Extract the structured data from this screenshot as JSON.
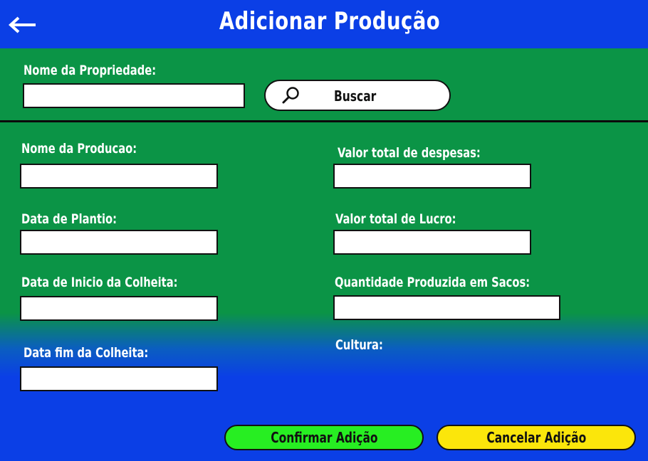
{
  "header": {
    "title": "Adicionar Produção",
    "back_icon": "arrow-left-icon"
  },
  "search_section": {
    "property_label": "Nome da Propriedade:",
    "property_value": "",
    "search_button_label": "Buscar",
    "search_icon": "magnifier-icon"
  },
  "form": {
    "left": {
      "production_name_label": "Nome da Producao:",
      "planting_date_label": "Data de Plantio:",
      "harvest_start_label": "Data de Inicio da Colheita:",
      "harvest_end_label": "Data fim da Colheita:"
    },
    "right": {
      "total_expenses_label": "Valor total de despesas:",
      "total_profit_label": "Valor total de Lucro:",
      "quantity_bags_label": "Quantidade Produzida em Sacos:",
      "culture_label": "Cultura:"
    }
  },
  "actions": {
    "confirm_label": "Confirmar Adição",
    "cancel_label": "Cancelar Adição"
  },
  "colors": {
    "header_blue": "#0b3fe6",
    "form_green": "#0b9446",
    "confirm_green": "#27ee22",
    "cancel_yellow": "#fbe60b"
  }
}
